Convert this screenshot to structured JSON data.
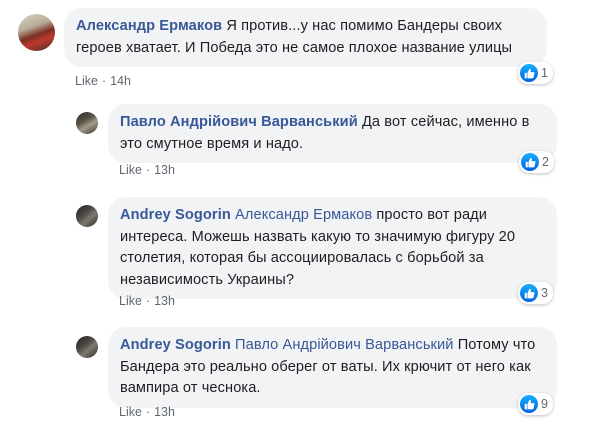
{
  "comments": [
    {
      "author": "Александр Ермаков",
      "mention": "",
      "text": "Я против...у нас помимо Бандеры своих героев хватает. И Победа это не самое плохое название улицы",
      "like_label": "Like",
      "time": "14h",
      "reaction_count": "1"
    },
    {
      "author": "Павло Андрійович Варванський",
      "mention": "",
      "text": "Да вот сейчас, именно в это смутное время и надо.",
      "like_label": "Like",
      "time": "13h",
      "reaction_count": "2"
    },
    {
      "author": "Andrey Sogorin",
      "mention": "Александр Ермаков",
      "text": "просто вот ради интереса. Можешь назвать какую то значимую фигуру 20 столетия, которая бы ассоциировалась с борьбой за независимость Украины?",
      "like_label": "Like",
      "time": "13h",
      "reaction_count": "3"
    },
    {
      "author": "Andrey Sogorin",
      "mention": "Павло Андрійович Варванський",
      "text": "Потому что Бандера это реально оберег от ваты. Их крючит от него как вампира от чеснока.",
      "like_label": "Like",
      "time": "13h",
      "reaction_count": "9"
    }
  ],
  "colors": {
    "author": "#385898",
    "bubble": "#f2f3f5",
    "meta": "#606770",
    "like_blue": "#1877f2"
  }
}
